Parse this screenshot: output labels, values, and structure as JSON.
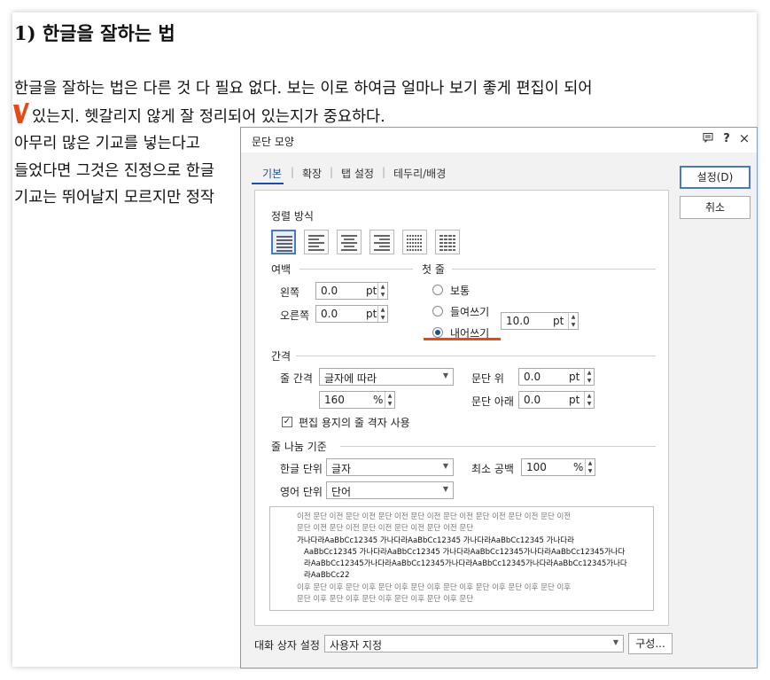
{
  "document": {
    "heading": "1) 한글을 잘하는 법",
    "lines": [
      "한글을 잘하는 법은 다른 것 다 필요 없다. 보는 이로 하여금 얼마나 보기 좋게 편집이 되어",
      "있는지. 헷갈리지 않게 잘 정리되어 있는지가 중요하다.",
      "아무리 많은 기교를 넣는다고",
      "들었다면 그것은 진정으로 한글",
      "기교는 뛰어날지 모르지만 정작"
    ],
    "accent_color": "#e64a19"
  },
  "dialog": {
    "title": "문단 모양",
    "title_icons": [
      "comment-icon",
      "help-icon",
      "close-icon"
    ],
    "help_label": "?",
    "close_label": "×",
    "tabs": [
      "기본",
      "확장",
      "탭 설정",
      "테두리/배경"
    ],
    "active_tab": "기본",
    "alignment": {
      "label": "정렬 방식",
      "options": [
        "justify",
        "left",
        "center",
        "right",
        "distribute",
        "divide"
      ],
      "selected": "justify"
    },
    "margins": {
      "label": "여백",
      "left_label": "왼쪽",
      "left_value": "0.0",
      "right_label": "오른쪽",
      "right_value": "0.0",
      "unit": "pt"
    },
    "first_line": {
      "label": "첫 줄",
      "options": [
        "보통",
        "들여쓰기",
        "내어쓰기"
      ],
      "selected": "내어쓰기",
      "value": "10.0",
      "unit": "pt"
    },
    "spacing": {
      "label": "간격",
      "line_spacing_label": "줄 간격",
      "line_spacing_type": "글자에 따라",
      "line_spacing_value": "160",
      "line_spacing_unit": "%",
      "para_above_label": "문단 위",
      "para_above_value": "0.0",
      "para_below_label": "문단 아래",
      "para_below_value": "0.0",
      "unit": "pt",
      "grid_checkbox_label": "편집 용지의 줄 격자 사용",
      "grid_checked": true
    },
    "line_break": {
      "label": "줄 나눔 기준",
      "korean_label": "한글 단위",
      "korean_value": "글자",
      "english_label": "영어 단위",
      "english_value": "단어",
      "min_space_label": "최소 공백",
      "min_space_value": "100",
      "min_space_unit": "%"
    },
    "preview": {
      "prev_lines": [
        "이전 문단 이전 문단 이전 문단 이전 문단 이전 문단 이전 문단 이전 문단 이전 문단 이전",
        "문단 이전 문단 이전 문단 이전 문단 이전 문단 이전 문단"
      ],
      "sample_lines": [
        "가나다라AaBbCc12345        가나다라AaBbCc12345        가나다라AaBbCc12345        가나다라",
        "AaBbCc12345   가나다라AaBbCc12345   가나다라AaBbCc12345가나다라AaBbCc12345가나다",
        "라AaBbCc12345가나다라AaBbCc12345가나다라AaBbCc12345가나다라AaBbCc12345가나다",
        "라AaBbCc22"
      ],
      "next_lines": [
        "이후 문단 이후 문단 이후 문단 이후 문단 이후 문단 이후 문단 이후 문단 이후 문단 이후",
        "문단 이후 문단 이후 문단 이후 문단 이후 문단 이후 문단"
      ]
    },
    "dialog_settings": {
      "label": "대화 상자 설정",
      "value": "사용자 지정",
      "configure_label": "구성..."
    },
    "buttons": {
      "ok_label": "설정(D)",
      "cancel_label": "취소"
    }
  }
}
